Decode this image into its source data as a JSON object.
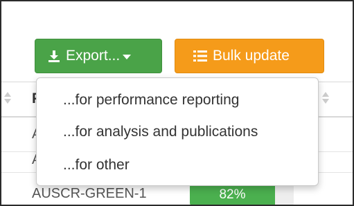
{
  "toolbar": {
    "export_label": "Export...",
    "bulk_update_label": "Bulk update"
  },
  "colors": {
    "export_button": "#4aa348",
    "bulk_button": "#f59b1a",
    "progress_fill": "#4bb04f"
  },
  "icons": {
    "export": "download-icon",
    "bulk_update": "list-icon",
    "caret": "caret-down-icon",
    "sort": "sort-icon"
  },
  "table": {
    "header_letter": "P",
    "rows": [
      {
        "letter": "A"
      },
      {
        "letter": "A"
      },
      {
        "letter": "A"
      }
    ],
    "last_row": {
      "code": "AUSCR-GREEN-1",
      "progress": {
        "label": "82%",
        "value_percent": 82
      }
    }
  },
  "export_menu": {
    "items": [
      {
        "label": "...for performance reporting"
      },
      {
        "label": "...for analysis and publications"
      },
      {
        "label": "...for other"
      }
    ]
  }
}
